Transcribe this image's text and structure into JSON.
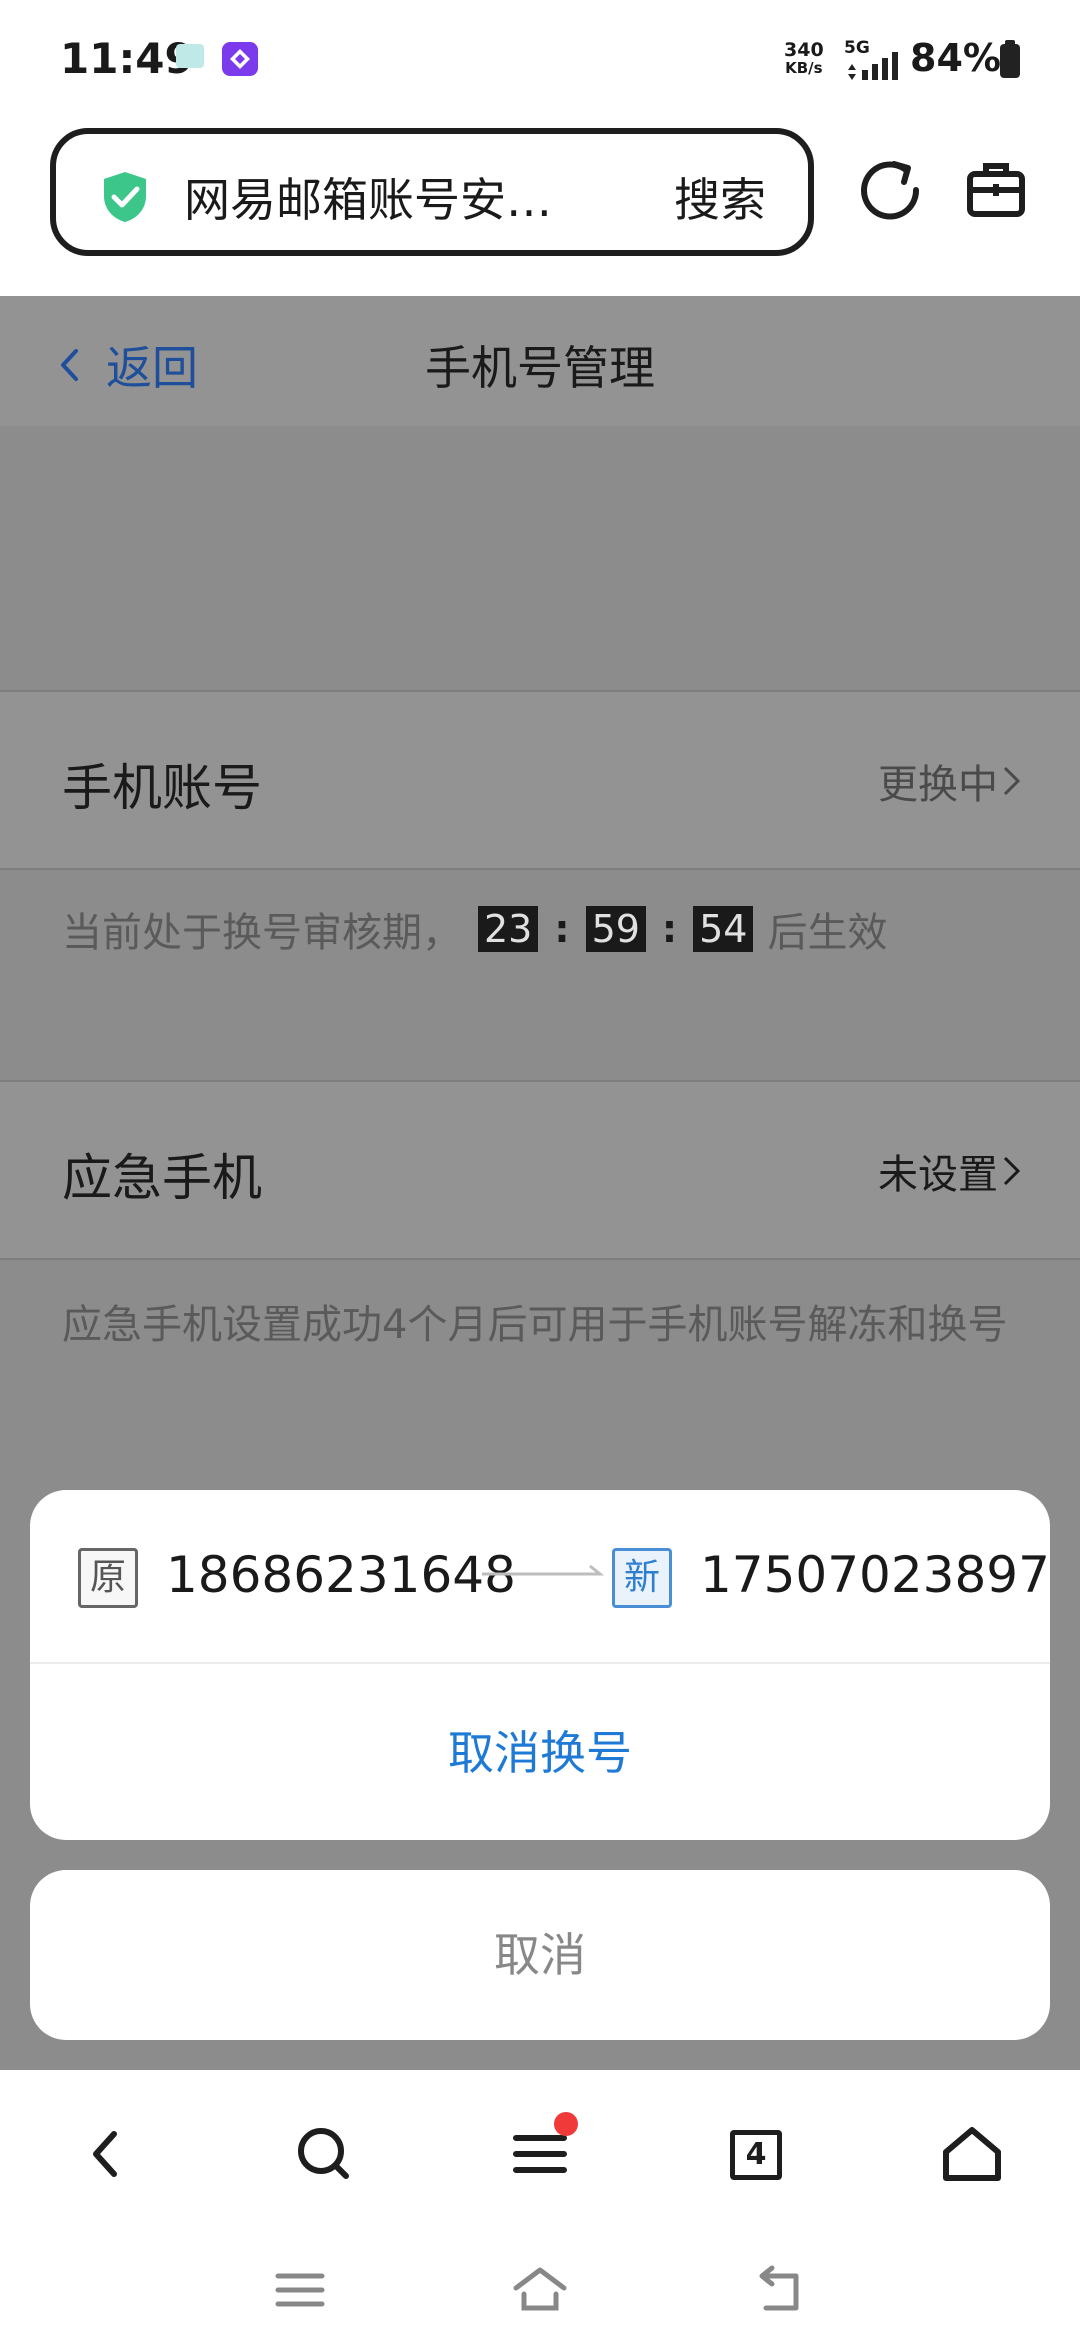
{
  "status_bar": {
    "time": "11:49",
    "net_speed_value": "340",
    "net_speed_unit": "KB/s",
    "network": "5G",
    "battery": "84%"
  },
  "browser": {
    "url_text": "网易邮箱账号安…",
    "search_label": "搜索",
    "icons": [
      "shield-check-icon",
      "reload-icon",
      "toolbox-icon"
    ]
  },
  "page": {
    "back_label": "返回",
    "title": "手机号管理",
    "phone_account": {
      "label": "手机账号",
      "status": "更换中"
    },
    "review_note": {
      "prefix": "当前处于换号审核期，",
      "hours": "23",
      "minutes": "59",
      "seconds": "54",
      "suffix": "后生效"
    },
    "emergency": {
      "label": "应急手机",
      "status": "未设置"
    },
    "emergency_note": "应急手机设置成功4个月后可用于手机账号解冻和换号"
  },
  "action_sheet": {
    "old_tag": "原",
    "old_number": "18686231648",
    "new_tag": "新",
    "new_number": "17507023897",
    "cancel_change_label": "取消换号",
    "cancel_label": "取消"
  },
  "toolbar": {
    "tabs_count": "4",
    "icons": [
      "back-icon",
      "search-icon",
      "menu-icon",
      "tabs-icon",
      "home-icon"
    ]
  },
  "colors": {
    "accent_blue": "#1f7ad6",
    "dim_overlay": "#8c8c8c",
    "badge_red": "#f03a3a",
    "shield_green": "#3cc68a"
  }
}
